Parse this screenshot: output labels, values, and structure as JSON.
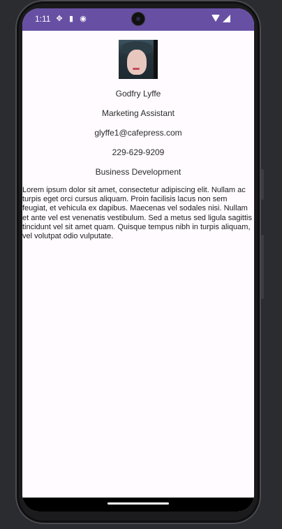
{
  "status_bar": {
    "time": "1:11",
    "left_icons": [
      "usb-debug-icon",
      "sd-card-icon",
      "sync-icon"
    ],
    "right_icons": [
      "wifi-icon",
      "cell-signal-icon"
    ],
    "background_color": "#6750a4"
  },
  "profile": {
    "name": "Godfry Lyffe",
    "title": "Marketing Assistant",
    "email": "glyffe1@cafepress.com",
    "phone": "229-629-9209",
    "department": "Business Development",
    "bio": "Lorem ipsum dolor sit amet, consectetur adipiscing elit. Nullam ac turpis eget orci cursus aliquam. Proin facilisis lacus non sem feugiat, et vehicula ex dapibus. Maecenas vel sodales nisi. Nullam et ante vel est venenatis vestibulum. Sed a metus sed ligula sagittis tincidunt vel sit amet quam. Quisque tempus nibh in turpis aliquam, vel volutpat odio vulputate."
  }
}
